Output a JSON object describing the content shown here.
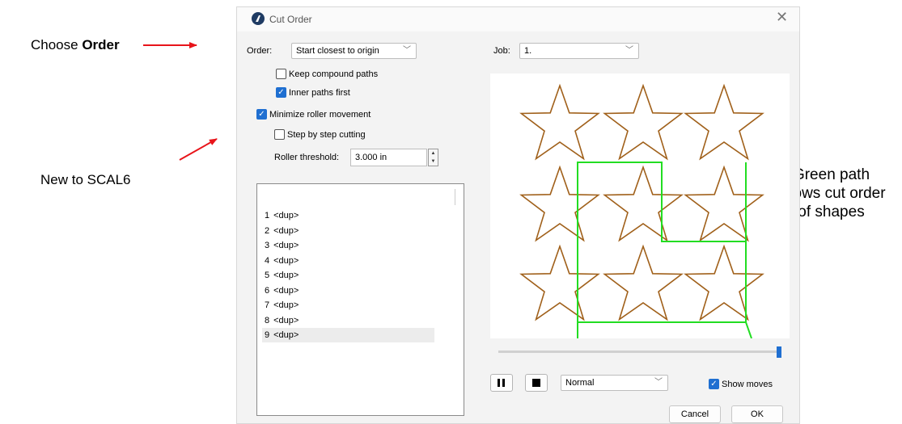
{
  "annotations": {
    "choose_prefix": "Choose ",
    "choose_bold": "Order",
    "new_to": "New to SCAL6",
    "green_line1": "Green path",
    "green_line2": "shows cut order",
    "green_line3": "of shapes"
  },
  "dialog": {
    "title": "Cut Order",
    "order_label": "Order:",
    "order_value": "Start closest to origin",
    "job_label": "Job:",
    "job_value": "1.",
    "keep_compound": {
      "label": "Keep compound paths",
      "checked": false
    },
    "inner_first": {
      "label": "Inner paths first",
      "checked": true
    },
    "minimize_roller": {
      "label": "Minimize roller movement",
      "checked": true
    },
    "step_by_step": {
      "label": "Step by step cutting",
      "checked": false
    },
    "roller_threshold_label": "Roller threshold:",
    "roller_threshold_value": "3.000 in",
    "items": [
      {
        "num": "1",
        "name": "<dup>"
      },
      {
        "num": "2",
        "name": "<dup>"
      },
      {
        "num": "3",
        "name": "<dup>"
      },
      {
        "num": "4",
        "name": "<dup>"
      },
      {
        "num": "5",
        "name": "<dup>"
      },
      {
        "num": "6",
        "name": "<dup>"
      },
      {
        "num": "7",
        "name": "<dup>"
      },
      {
        "num": "8",
        "name": "<dup>"
      },
      {
        "num": "9",
        "name": "<dup>"
      }
    ],
    "selected_item": 9,
    "progress": 1.0,
    "speed_value": "Normal",
    "show_moves": {
      "label": "Show moves",
      "checked": true
    },
    "cancel_label": "Cancel",
    "ok_label": "OK"
  },
  "colors": {
    "star_outline": "#a0601a",
    "path_green": "#22dd22",
    "accent_blue": "#1f6fd1",
    "annotation_arrow": "#e8141a"
  }
}
